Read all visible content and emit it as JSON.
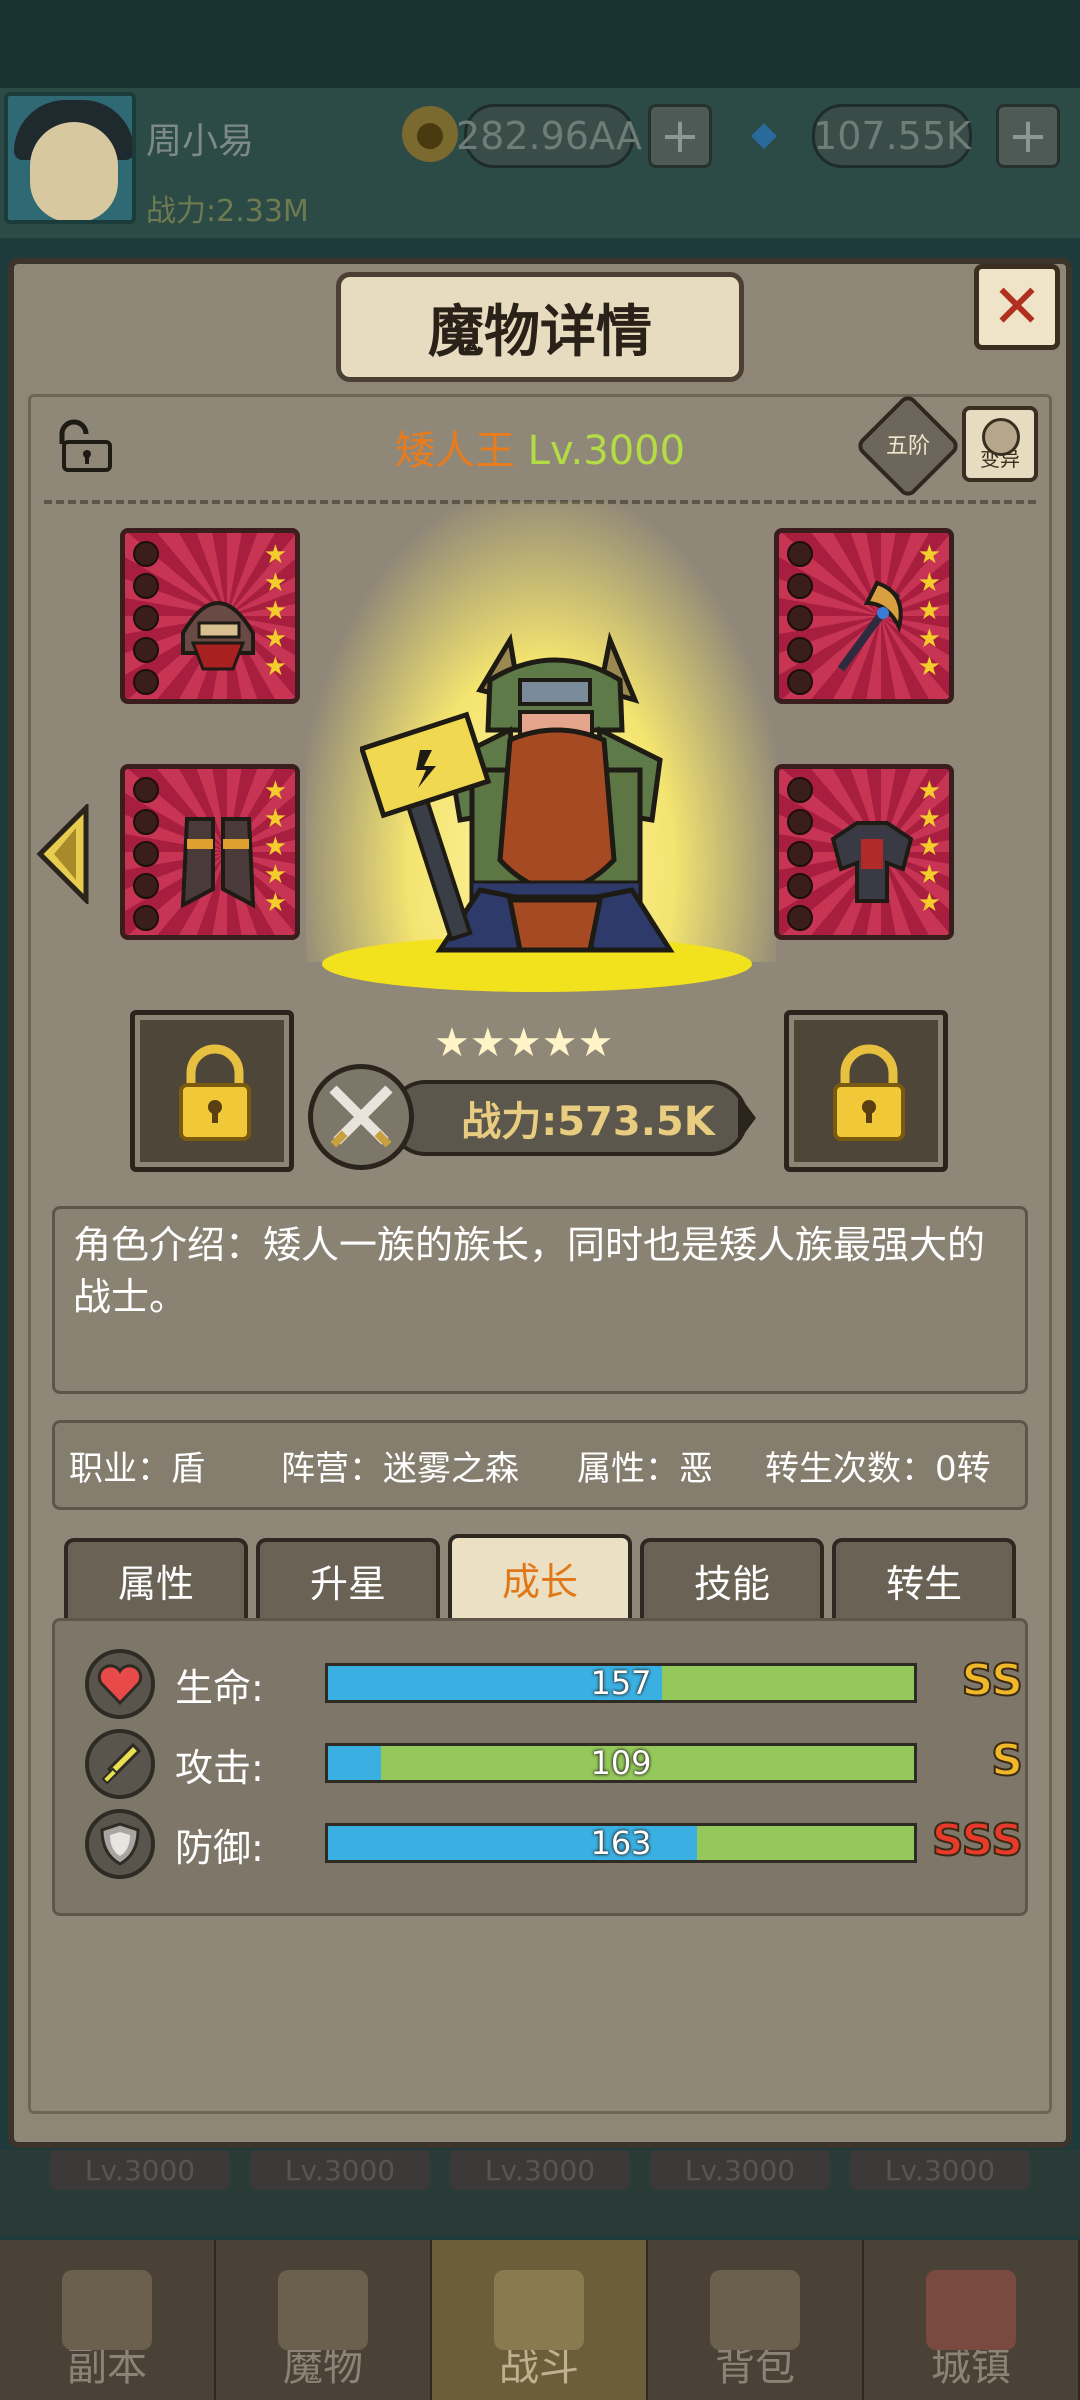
{
  "player": {
    "name": "周小易",
    "power": "战力:2.33M",
    "gold": "282.96AA",
    "diamond": "107.55K"
  },
  "modal": {
    "title": "魔物详情",
    "close": "✕",
    "rank": "五阶",
    "mutate": "变异"
  },
  "monster": {
    "name": "矮人王",
    "level": "Lv.3000",
    "stars": "★★★★★",
    "power": "战力:573.5K",
    "description": "角色介绍：矮人一族的族长，同时也是矮人族最强大的战士。"
  },
  "info": {
    "job": "职业：盾",
    "camp": "阵营：迷雾之森",
    "attribute": "属性：恶",
    "rebirth": "转生次数：0转"
  },
  "tabs": [
    "属性",
    "升星",
    "成长",
    "技能",
    "转生"
  ],
  "active_tab": "成长",
  "stats": [
    {
      "label": "生命:",
      "value": "157",
      "fill": 0.57,
      "grade": "SS",
      "grade_color": "#f0b828"
    },
    {
      "label": "攻击:",
      "value": "109",
      "fill": 0.09,
      "grade": "S",
      "grade_color": "#f0b828"
    },
    {
      "label": "防御:",
      "value": "163",
      "fill": 0.63,
      "grade": "SSS",
      "grade_color": "#e83a2a"
    }
  ],
  "bottom_levels": [
    "Lv.3000",
    "Lv.3000",
    "Lv.3000",
    "Lv.3000",
    "Lv.3000"
  ],
  "nav": [
    "副本",
    "魔物",
    "战斗",
    "背包",
    "城镇"
  ],
  "nav_active": "战斗",
  "colors": {
    "accent": "#e07818",
    "bar_blue": "#3ab0e2",
    "bar_green": "#94c85a",
    "slot_red": "#b8284a"
  }
}
